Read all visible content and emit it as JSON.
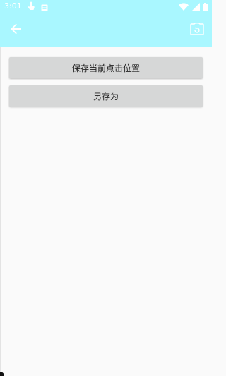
{
  "status_bar": {
    "time": "3:01",
    "left_icons": [
      "touch-icon",
      "notification-square-icon"
    ],
    "right_icons": [
      "wifi-icon",
      "signal-icon",
      "battery-icon"
    ]
  },
  "app_bar": {
    "back_icon": "arrow-back-icon",
    "action_icon": "screenshot-frame-icon",
    "background_color": "#a9f7ff"
  },
  "actions": {
    "save_current_position_label": "保存当前点击位置",
    "save_as_label": "另存为"
  }
}
